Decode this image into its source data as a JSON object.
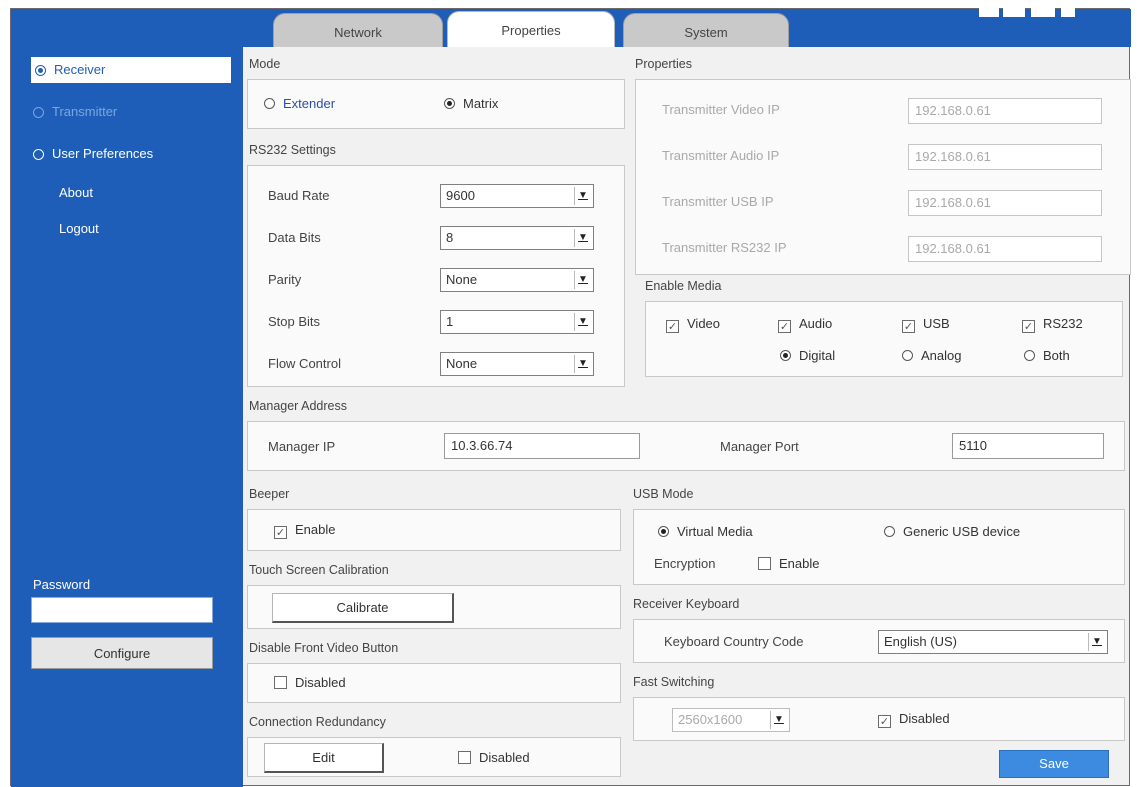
{
  "tabs": [
    {
      "label": "Network"
    },
    {
      "label": "Properties"
    },
    {
      "label": "System"
    }
  ],
  "sidebar": {
    "items": [
      {
        "label": "Receiver"
      },
      {
        "label": "Transmitter"
      },
      {
        "label": "User Preferences"
      }
    ],
    "links": [
      {
        "label": "About"
      },
      {
        "label": "Logout"
      }
    ],
    "password_label": "Password",
    "password_value": "",
    "configure_label": "Configure"
  },
  "mode": {
    "title": "Mode",
    "options": [
      "Extender",
      "Matrix"
    ],
    "selected": "Matrix"
  },
  "rs232": {
    "title": "RS232 Settings",
    "rows": [
      {
        "label": "Baud Rate",
        "value": "9600"
      },
      {
        "label": "Data Bits",
        "value": "8"
      },
      {
        "label": "Parity",
        "value": "None"
      },
      {
        "label": "Stop Bits",
        "value": "1"
      },
      {
        "label": "Flow Control",
        "value": "None"
      }
    ]
  },
  "properties": {
    "title": "Properties",
    "rows": [
      {
        "label": "Transmitter Video IP",
        "value": "192.168.0.61"
      },
      {
        "label": "Transmitter Audio IP",
        "value": "192.168.0.61"
      },
      {
        "label": "Transmitter USB IP",
        "value": "192.168.0.61"
      },
      {
        "label": "Transmitter RS232 IP",
        "value": "192.168.0.61"
      }
    ]
  },
  "enable_media": {
    "title": "Enable Media",
    "checks": [
      "Video",
      "Audio",
      "USB",
      "RS232"
    ],
    "audio_options": [
      "Digital",
      "Analog",
      "Both"
    ],
    "audio_selected": "Digital"
  },
  "manager": {
    "title": "Manager Address",
    "ip_label": "Manager IP",
    "ip_value": "10.3.66.74",
    "port_label": "Manager Port",
    "port_value": "5110"
  },
  "beeper": {
    "title": "Beeper",
    "enable_label": "Enable"
  },
  "touch": {
    "title": "Touch Screen Calibration",
    "calibrate_label": "Calibrate"
  },
  "front_video": {
    "title": "Disable Front Video Button",
    "disabled_label": "Disabled"
  },
  "redundancy": {
    "title": "Connection Redundancy",
    "edit_label": "Edit",
    "disabled_label": "Disabled"
  },
  "usb_mode": {
    "title": "USB Mode",
    "options": [
      "Virtual Media",
      "Generic USB device"
    ],
    "selected": "Virtual Media",
    "encryption_label": "Encryption",
    "encryption_enable_label": "Enable"
  },
  "keyboard": {
    "title": "Receiver Keyboard",
    "country_label": "Keyboard Country Code",
    "country_value": "English (US)"
  },
  "fast_switching": {
    "title": "Fast Switching",
    "resolution": "2560x1600",
    "disabled_label": "Disabled"
  },
  "save_label": "Save",
  "colors": {
    "accent": "#1f5eb8",
    "save": "#3d8be0"
  }
}
